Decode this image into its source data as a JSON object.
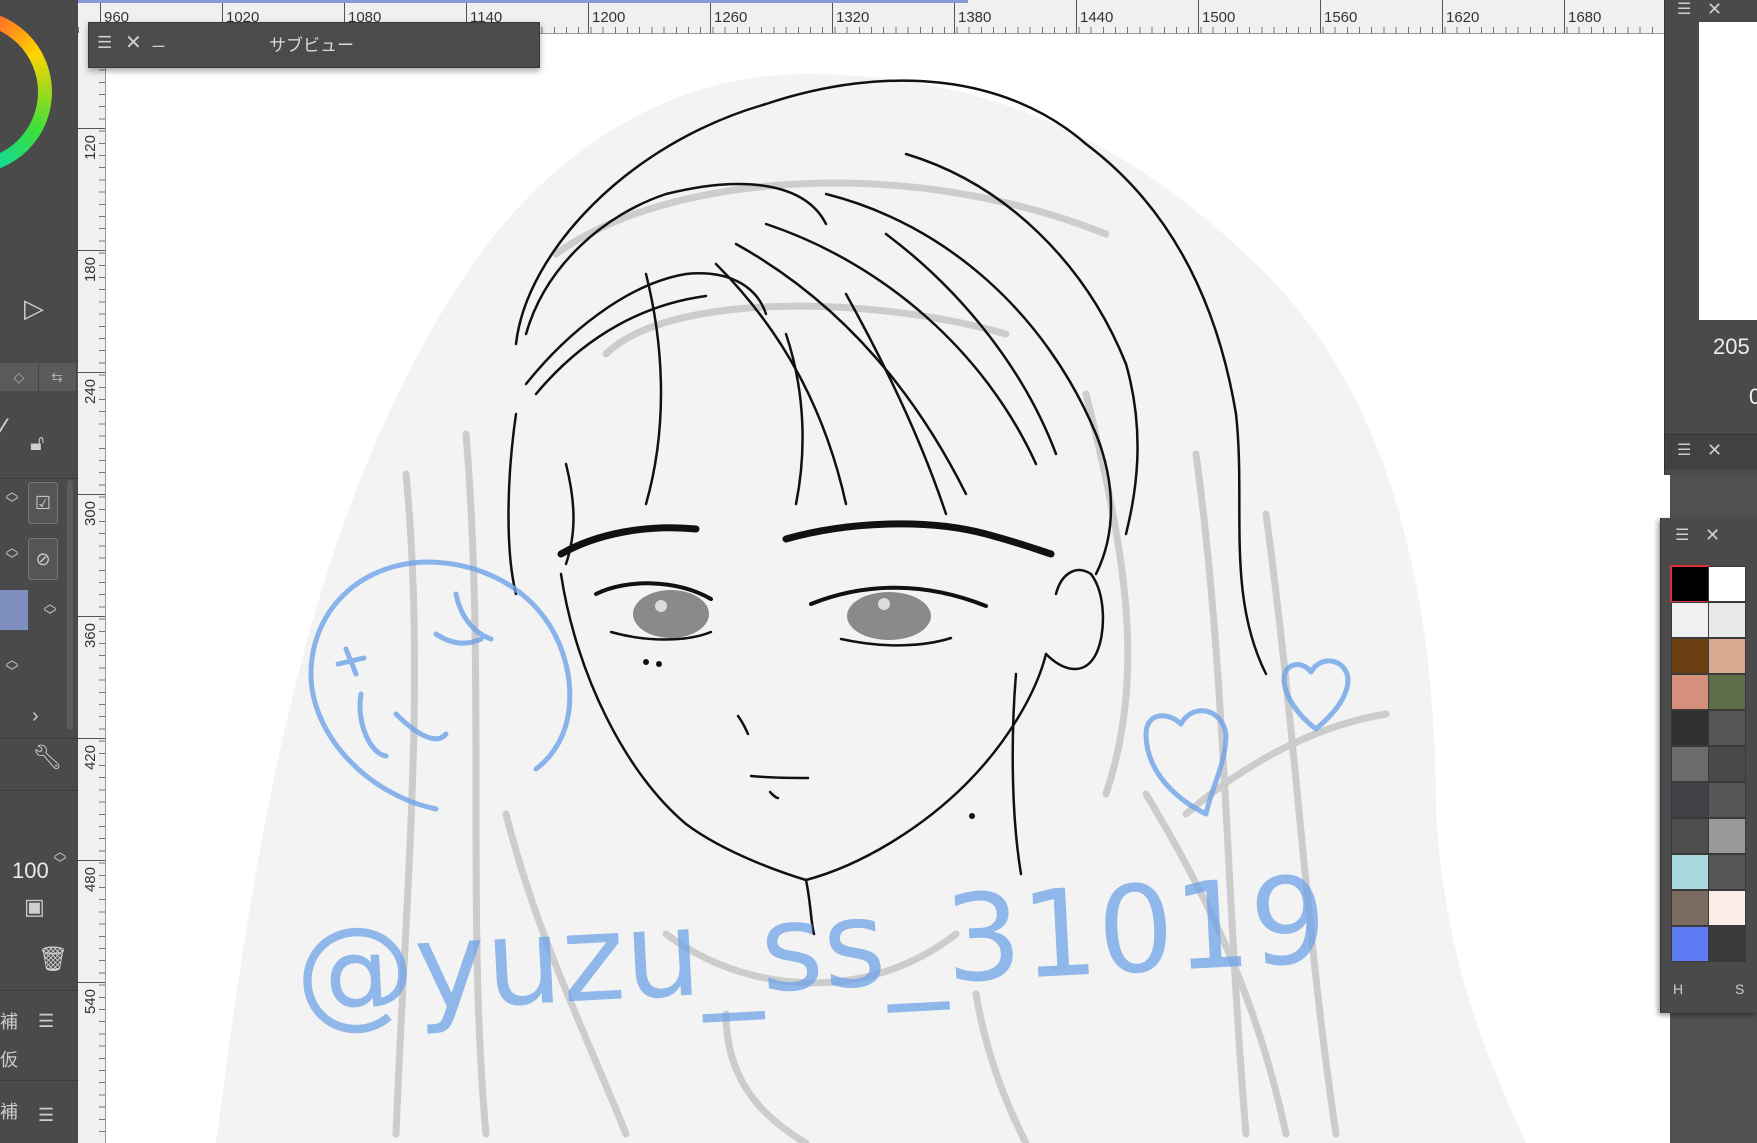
{
  "subview": {
    "title": "サブビュー"
  },
  "ruler_top": [
    "960",
    "1020",
    "1080",
    "1140",
    "1200",
    "1260",
    "1320",
    "1380",
    "1440",
    "1500",
    "1560",
    "1620",
    "1680"
  ],
  "ruler_left": [
    "120",
    "180",
    "240",
    "300",
    "360",
    "420",
    "480",
    "540"
  ],
  "left_panel": {
    "opacity_value": "100",
    "label_1": "補",
    "label_2": "仮",
    "label_3": "補"
  },
  "right_panel": {
    "value_1": "205",
    "value_2": "0"
  },
  "palette": {
    "tab_h": "H",
    "tab_s": "S",
    "swatches": [
      "#000000",
      "#ffffff",
      "#f0f0f0",
      "#e8e8e8",
      "#6b3f14",
      "#d8a890",
      "#d4907a",
      "#5f6e48",
      "#2f2f2f",
      "#555555",
      "#6b6b6b",
      "#4a4a4a",
      "#444048",
      "#565656",
      "#4d4d4d",
      "#9a9a9a",
      "#a8d8dc",
      "#555555",
      "#7a6a60",
      "#faeee6",
      "#5f7cf5",
      "#3a3a3a"
    ]
  },
  "artwork": {
    "signature": "@yuzu_ss_31019",
    "ink_color": "#111111",
    "sketch_color": "#b8b8b8",
    "accent_color": "#6ea3e8"
  }
}
